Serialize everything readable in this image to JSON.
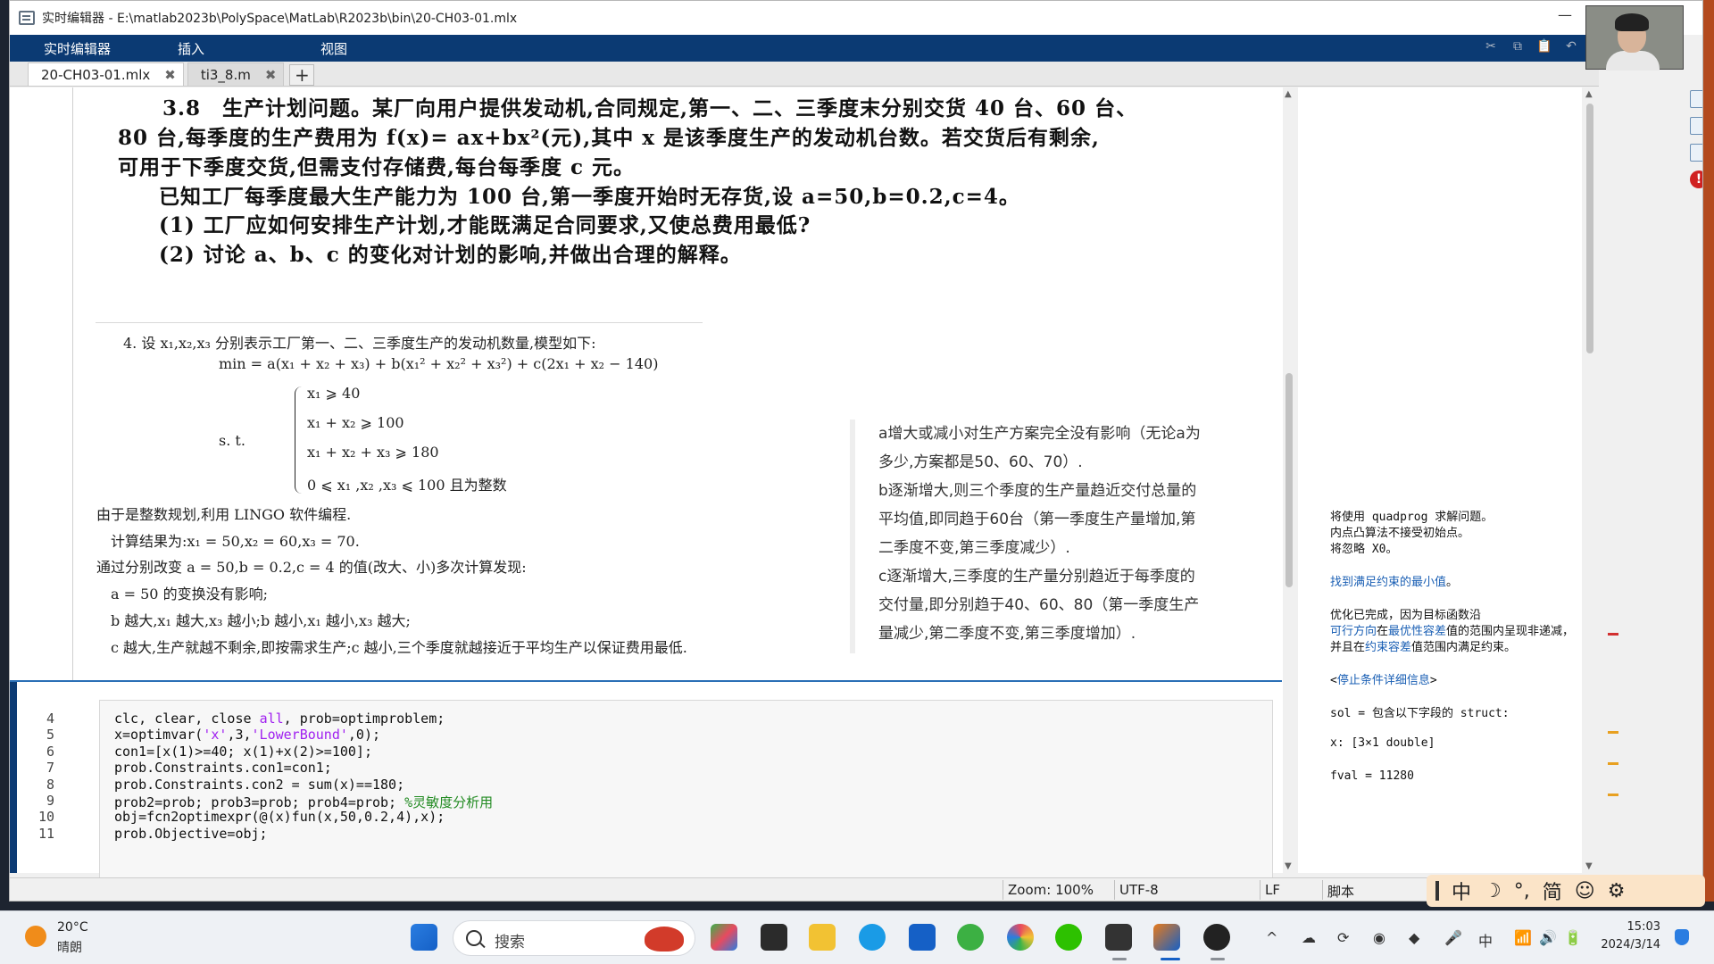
{
  "window": {
    "title": "实时编辑器 - E:\\matlab2023b\\PolySpace\\MatLab\\R2023b\\bin\\20-CH03-01.mlx",
    "minimize_glyph": "—"
  },
  "ribbon": {
    "tabs": [
      "实时编辑器",
      "插入",
      "视图"
    ],
    "tools": [
      "cut-icon",
      "copy-icon",
      "paste-icon",
      "undo-icon"
    ]
  },
  "file_tabs": [
    {
      "label": "20-CH03-01.mlx",
      "close": "✖",
      "active": true
    },
    {
      "label": "ti3_8.m",
      "close": "✖",
      "active": false
    }
  ],
  "add_tab_glyph": "+",
  "problem": {
    "lines": [
      "3.8　生产计划问题。某厂向用户提供发动机,合同规定,第一、二、三季度末分别交货 40 台、60 台、",
      "80 台,每季度的生产费用为 f(x)= ax+bx²(元),其中 x 是该季度生产的发动机台数。若交货后有剩余,",
      "可用于下季度交货,但需支付存储费,每台每季度 c 元。",
      "　已知工厂每季度最大生产能力为 100 台,第一季度开始时无存货,设 a=50,b=0.2,c=4。",
      "　(1) 工厂应如何安排生产计划,才能既满足合同要求,又使总费用最低?",
      "　(2) 讨论 a、b、c 的变化对计划的影响,并做出合理的解释。"
    ]
  },
  "solution": {
    "intro": "4. 设 x₁,x₂,x₃ 分别表示工厂第一、二、三季度生产的发动机数量,模型如下:",
    "objective": "min = a(x₁ + x₂ + x₃) + b(x₁² + x₂² + x₃²) + c(2x₁ + x₂ − 140)",
    "st_label": "s. t.",
    "constraints": [
      "x₁ ⩾ 40",
      "x₁ + x₂ ⩾ 100",
      "x₁ + x₂ + x₃ ⩾ 180",
      "0 ⩽ x₁ ,x₂ ,x₃ ⩽ 100 且为整数"
    ],
    "after": [
      "由于是整数规划,利用 LINGO 软件编程.",
      "　计算结果为:x₁ = 50,x₂ = 60,x₃ = 70.",
      "通过分别改变 a = 50,b = 0.2,c = 4 的值(改大、小)多次计算发现:",
      "　a = 50 的变换没有影响;",
      "　b 越大,x₁ 越大,x₃ 越小;b 越小,x₁ 越小,x₃ 越大;",
      "　c 越大,生产就越不剩余,即按需求生产;c 越小,三个季度就越接近于平均生产以保证费用最低."
    ]
  },
  "notes": [
    "a增大或减小对生产方案完全没有影响（无论a为",
    "多少,方案都是50、60、70）.",
    "b逐渐增大,则三个季度的生产量趋近交付总量的",
    "平均值,即同趋于60台（第一季度生产量增加,第",
    "二季度不变,第三季度减少）.",
    "c逐渐增大,三季度的生产量分别趋近于每季度的",
    "交付量,即分别趋于40、60、80（第一季度生产",
    "量减少,第二季度不变,第三季度增加）."
  ],
  "code": {
    "line_numbers": [
      "4",
      "5",
      "6",
      "7",
      "8",
      "9",
      "10",
      "11"
    ],
    "lines": [
      [
        {
          "t": "clc, clear, close "
        },
        {
          "t": "all",
          "c": "str"
        },
        {
          "t": ", prob=optimproblem;"
        }
      ],
      [
        {
          "t": "x=optimvar("
        },
        {
          "t": "'x'",
          "c": "str"
        },
        {
          "t": ",3,"
        },
        {
          "t": "'LowerBound'",
          "c": "str"
        },
        {
          "t": ",0);"
        }
      ],
      [
        {
          "t": "con1=[x(1)>=40; x(1)+x(2)>=100];"
        }
      ],
      [
        {
          "t": "prob.Constraints.con1=con1;"
        }
      ],
      [
        {
          "t": "prob.Constraints.con2 = sum(x)==180;"
        }
      ],
      [
        {
          "t": "prob2=prob; prob3=prob; prob4=prob; "
        },
        {
          "t": "%灵敏度分析用",
          "c": "cmt"
        }
      ],
      [
        {
          "t": "obj=fcn2optimexpr(@(x)fun(x,50,0.2,4),x);"
        }
      ],
      [
        {
          "t": "prob.Objective=obj;"
        }
      ]
    ]
  },
  "output": {
    "lines": [
      [
        {
          "t": "将使用 quadprog 求解问题。"
        }
      ],
      [
        {
          "t": "内点凸算法不接受初始点。"
        }
      ],
      [
        {
          "t": "将忽略 X0。"
        }
      ],
      [
        {
          "t": ""
        }
      ],
      [
        {
          "t": "找到满足约束的最小值",
          "link": true
        },
        {
          "t": "。"
        }
      ],
      [
        {
          "t": ""
        }
      ],
      [
        {
          "t": "优化已完成，因为目标函数沿"
        }
      ],
      [
        {
          "t": "可行方向",
          "link": true
        },
        {
          "t": "在"
        },
        {
          "t": "最优性容差",
          "link": true
        },
        {
          "t": "值的范围内呈现非递减，"
        }
      ],
      [
        {
          "t": "并且在"
        },
        {
          "t": "约束容差",
          "link": true
        },
        {
          "t": "值范围内满足约束。"
        }
      ],
      [
        {
          "t": ""
        }
      ],
      [
        {
          "t": "<"
        },
        {
          "t": "停止条件详细信息",
          "link": true
        },
        {
          "t": ">"
        }
      ],
      [
        {
          "t": ""
        }
      ],
      [
        {
          "t": "sol = 包含以下字段的 struct:"
        }
      ],
      [
        {
          "t": ""
        }
      ],
      [
        {
          "t": "    x: [3×1 double]"
        }
      ],
      [
        {
          "t": ""
        }
      ],
      [
        {
          "t": "fval = 11280"
        }
      ]
    ]
  },
  "status": {
    "zoom": "Zoom: 100%",
    "encoding": "UTF-8",
    "eol": "LF",
    "type": "脚本"
  },
  "ime": {
    "items": [
      "中",
      "☽",
      "°,",
      "简",
      "☺",
      "⚙"
    ]
  },
  "taskbar": {
    "temperature": "20°C",
    "weather": "晴朗",
    "search_placeholder": "搜索",
    "time": "15:03",
    "date": "2024/3/14",
    "tray": [
      "^",
      "中"
    ]
  },
  "colors": {
    "ribbon": "#0b3a73",
    "link": "#1a5fb4",
    "string": "#a020f0",
    "comment": "#228b22"
  }
}
